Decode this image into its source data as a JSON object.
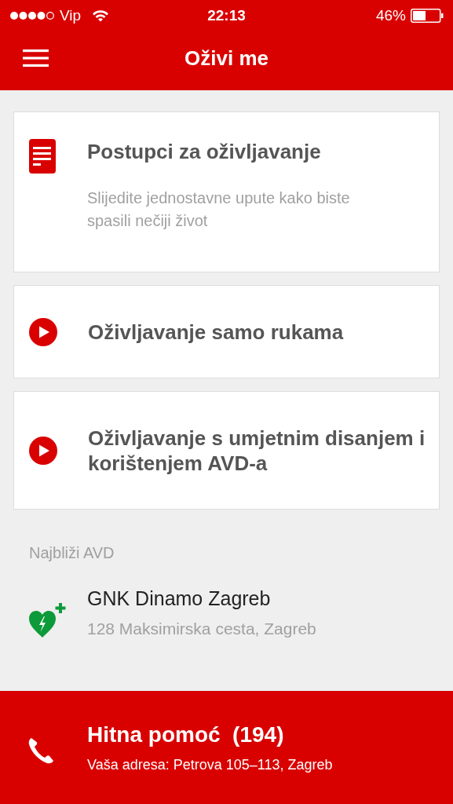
{
  "status_bar": {
    "carrier": "Vip",
    "time": "22:13",
    "battery": "46%"
  },
  "nav": {
    "title": "Oživi me"
  },
  "cards": [
    {
      "kind": "document",
      "title": "Postupci za oživljavanje",
      "subtitle": "Slijedite jednostavne upute kako biste spasili nečiji život"
    },
    {
      "kind": "video",
      "title": "Oživljavanje samo rukama"
    },
    {
      "kind": "video",
      "title": "Oživljavanje s umjetnim disanjem i korištenjem AVD-a"
    }
  ],
  "nearest": {
    "heading": "Najbliži AVD",
    "name": "GNK Dinamo Zagreb",
    "address": "128 Maksimirska cesta, Zagreb"
  },
  "emergency": {
    "title": "Hitna pomoć  (194)",
    "address": "Vaša adresa: Petrova 105–113, Zagreb"
  }
}
